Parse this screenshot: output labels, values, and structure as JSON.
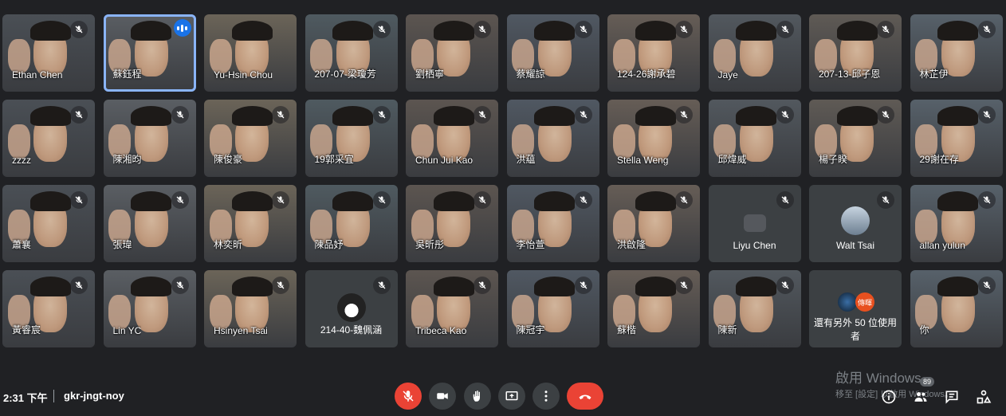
{
  "participants": [
    {
      "name": "Ethan Chen",
      "muted": true
    },
    {
      "name": "蘇鈺程",
      "muted": false,
      "speaking": true,
      "active": true
    },
    {
      "name": "Yu-Hsin Chou",
      "muted": false
    },
    {
      "name": "207-07-梁瓊芳",
      "muted": true
    },
    {
      "name": "劉栖寧",
      "muted": true
    },
    {
      "name": "蔡耀諒",
      "muted": true
    },
    {
      "name": "124-26謝承碧",
      "muted": true
    },
    {
      "name": "Jaye",
      "muted": true
    },
    {
      "name": "207-13-邱子恩",
      "muted": true
    },
    {
      "name": "林芷伊",
      "muted": true
    },
    {
      "name": "zzzz",
      "muted": true
    },
    {
      "name": "陳湘昀",
      "muted": true
    },
    {
      "name": "陳俊豪",
      "muted": true
    },
    {
      "name": "19郭采宜",
      "muted": true
    },
    {
      "name": "Chun Jui Kao",
      "muted": true
    },
    {
      "name": "洪蘊",
      "muted": true
    },
    {
      "name": "Stella Weng",
      "muted": true
    },
    {
      "name": "邱煒威",
      "muted": true
    },
    {
      "name": "楊子睽",
      "muted": true
    },
    {
      "name": "29謝在存",
      "muted": true
    },
    {
      "name": "蕭襄",
      "muted": true
    },
    {
      "name": "張瑋",
      "muted": true
    },
    {
      "name": "林奕昕",
      "muted": true
    },
    {
      "name": "陳品妤",
      "muted": true
    },
    {
      "name": "吳昕彤",
      "muted": true
    },
    {
      "name": "李怡萱",
      "muted": true
    },
    {
      "name": "洪啟隆",
      "muted": true
    },
    {
      "name": "Liyu Chen",
      "muted": true,
      "type": "camera-off"
    },
    {
      "name": "Walt Tsai",
      "muted": true,
      "type": "avatar"
    },
    {
      "name": "allan yulun",
      "muted": true
    },
    {
      "name": "黃睿宸",
      "muted": true
    },
    {
      "name": "Lin YC",
      "muted": true
    },
    {
      "name": "Hsinyen Tsai",
      "muted": true
    },
    {
      "name": "214-40-魏佩涵",
      "muted": true,
      "type": "cat"
    },
    {
      "name": "Tribeca Kao",
      "muted": true
    },
    {
      "name": "陳冠宇",
      "muted": true
    },
    {
      "name": "蘇楷",
      "muted": true
    },
    {
      "name": "陳新",
      "muted": true
    },
    {
      "name": "還有另外 50 位使用者",
      "type": "others",
      "badge": "傳暉"
    },
    {
      "name": "你",
      "muted": true
    }
  ],
  "footer": {
    "time": "2:31 下午",
    "meeting_code": "gkr-jngt-noy",
    "participant_count": "89"
  },
  "watermark": {
    "line1": "啟用 Windows",
    "line2": "移至 [設定] 以啟用 Windows。"
  },
  "icons": {
    "mic": "mic-off-icon",
    "camera": "videocam-icon",
    "hand": "raise-hand-icon",
    "present": "present-screen-icon",
    "more": "more-vert-icon",
    "end": "call-end-icon",
    "info": "info-icon",
    "people": "people-icon",
    "chat": "chat-icon",
    "activities": "activities-icon"
  },
  "colors": {
    "background": "#202124",
    "danger": "#ea4335",
    "active": "#8ab4f8"
  }
}
